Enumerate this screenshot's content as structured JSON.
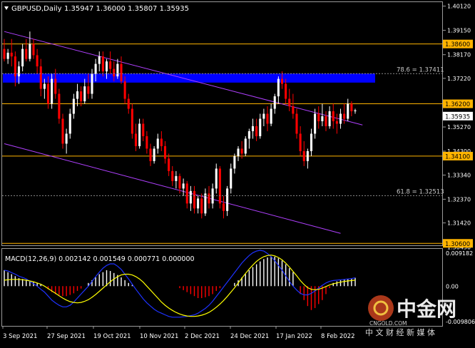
{
  "header": {
    "symbol_label": "GBPUSD,Daily",
    "ohlc_label": "1.35947 1.36000 1.35807 1.35935"
  },
  "macd_header": {
    "label": "MACD(12,26,9) 0.002142 0.001549 0.000771 0.000000"
  },
  "watermark": {
    "brand_cn": "中金网",
    "brand_url": "CNGOLD.COM",
    "tagline_cn": "中 文 财 经 新 媒 体"
  },
  "colors": {
    "background": "#000000",
    "bull": "#ffffff",
    "bear": "#ff0000",
    "level": "#ffb400",
    "zone": "#0000ff",
    "channel": "#b040ff",
    "macd_signal": "#ffff00",
    "macd_line": "#1e32ff",
    "macd_hist": "#ffffff"
  },
  "chart_data": {
    "type": "candlestick",
    "symbol": "GBPUSD",
    "timeframe": "Daily",
    "price_axis": {
      "range": [
        1.3055,
        1.4025
      ],
      "ticks": [
        "1.40120",
        "1.39150",
        "1.38170",
        "1.37220",
        "1.36250",
        "1.35270",
        "1.34300",
        "1.33340",
        "1.32370",
        "1.31420",
        "1.30450"
      ]
    },
    "date_axis": {
      "labels": [
        "3 Sep 2021",
        "27 Sep 2021",
        "19 Oct 2021",
        "10 Nov 2021",
        "2 Dec 2021",
        "24 Dec 2021",
        "17 Jan 2022",
        "8 Feb 2022"
      ]
    },
    "ohlc": [
      {
        "o": 1.384,
        "h": 1.388,
        "l": 1.379,
        "c": 1.38
      },
      {
        "o": 1.38,
        "h": 1.384,
        "l": 1.378,
        "c": 1.3825
      },
      {
        "o": 1.3825,
        "h": 1.388,
        "l": 1.377,
        "c": 1.381
      },
      {
        "o": 1.381,
        "h": 1.383,
        "l": 1.369,
        "c": 1.373
      },
      {
        "o": 1.373,
        "h": 1.379,
        "l": 1.37,
        "c": 1.377
      },
      {
        "o": 1.377,
        "h": 1.386,
        "l": 1.375,
        "c": 1.384
      },
      {
        "o": 1.384,
        "h": 1.388,
        "l": 1.379,
        "c": 1.38
      },
      {
        "o": 1.38,
        "h": 1.391,
        "l": 1.379,
        "c": 1.386
      },
      {
        "o": 1.386,
        "h": 1.388,
        "l": 1.38,
        "c": 1.3815
      },
      {
        "o": 1.3815,
        "h": 1.384,
        "l": 1.374,
        "c": 1.377
      },
      {
        "o": 1.377,
        "h": 1.38,
        "l": 1.365,
        "c": 1.368
      },
      {
        "o": 1.368,
        "h": 1.372,
        "l": 1.364,
        "c": 1.37
      },
      {
        "o": 1.37,
        "h": 1.373,
        "l": 1.36,
        "c": 1.362
      },
      {
        "o": 1.362,
        "h": 1.374,
        "l": 1.36,
        "c": 1.372
      },
      {
        "o": 1.372,
        "h": 1.376,
        "l": 1.364,
        "c": 1.366
      },
      {
        "o": 1.366,
        "h": 1.368,
        "l": 1.354,
        "c": 1.356
      },
      {
        "o": 1.356,
        "h": 1.358,
        "l": 1.344,
        "c": 1.346
      },
      {
        "o": 1.346,
        "h": 1.352,
        "l": 1.342,
        "c": 1.35
      },
      {
        "o": 1.35,
        "h": 1.36,
        "l": 1.348,
        "c": 1.358
      },
      {
        "o": 1.358,
        "h": 1.366,
        "l": 1.356,
        "c": 1.364
      },
      {
        "o": 1.364,
        "h": 1.37,
        "l": 1.361,
        "c": 1.367
      },
      {
        "o": 1.367,
        "h": 1.369,
        "l": 1.361,
        "c": 1.363
      },
      {
        "o": 1.363,
        "h": 1.372,
        "l": 1.362,
        "c": 1.369
      },
      {
        "o": 1.369,
        "h": 1.374,
        "l": 1.364,
        "c": 1.366
      },
      {
        "o": 1.366,
        "h": 1.376,
        "l": 1.364,
        "c": 1.374
      },
      {
        "o": 1.374,
        "h": 1.38,
        "l": 1.371,
        "c": 1.378
      },
      {
        "o": 1.378,
        "h": 1.383,
        "l": 1.375,
        "c": 1.381
      },
      {
        "o": 1.381,
        "h": 1.383,
        "l": 1.373,
        "c": 1.375
      },
      {
        "o": 1.375,
        "h": 1.38,
        "l": 1.372,
        "c": 1.379
      },
      {
        "o": 1.379,
        "h": 1.383,
        "l": 1.374,
        "c": 1.376
      },
      {
        "o": 1.376,
        "h": 1.379,
        "l": 1.371,
        "c": 1.373
      },
      {
        "o": 1.373,
        "h": 1.38,
        "l": 1.372,
        "c": 1.378
      },
      {
        "o": 1.378,
        "h": 1.381,
        "l": 1.37,
        "c": 1.371
      },
      {
        "o": 1.371,
        "h": 1.373,
        "l": 1.362,
        "c": 1.364
      },
      {
        "o": 1.364,
        "h": 1.366,
        "l": 1.358,
        "c": 1.36
      },
      {
        "o": 1.36,
        "h": 1.362,
        "l": 1.348,
        "c": 1.35
      },
      {
        "o": 1.35,
        "h": 1.354,
        "l": 1.343,
        "c": 1.345
      },
      {
        "o": 1.345,
        "h": 1.356,
        "l": 1.344,
        "c": 1.354
      },
      {
        "o": 1.354,
        "h": 1.356,
        "l": 1.347,
        "c": 1.349
      },
      {
        "o": 1.349,
        "h": 1.351,
        "l": 1.342,
        "c": 1.344
      },
      {
        "o": 1.344,
        "h": 1.346,
        "l": 1.337,
        "c": 1.339
      },
      {
        "o": 1.339,
        "h": 1.345,
        "l": 1.338,
        "c": 1.344
      },
      {
        "o": 1.344,
        "h": 1.35,
        "l": 1.342,
        "c": 1.348
      },
      {
        "o": 1.348,
        "h": 1.351,
        "l": 1.343,
        "c": 1.345
      },
      {
        "o": 1.345,
        "h": 1.347,
        "l": 1.338,
        "c": 1.34
      },
      {
        "o": 1.34,
        "h": 1.342,
        "l": 1.333,
        "c": 1.335
      },
      {
        "o": 1.335,
        "h": 1.337,
        "l": 1.329,
        "c": 1.331
      },
      {
        "o": 1.331,
        "h": 1.335,
        "l": 1.328,
        "c": 1.333
      },
      {
        "o": 1.333,
        "h": 1.334,
        "l": 1.326,
        "c": 1.328
      },
      {
        "o": 1.328,
        "h": 1.332,
        "l": 1.325,
        "c": 1.33
      },
      {
        "o": 1.33,
        "h": 1.331,
        "l": 1.32,
        "c": 1.322
      },
      {
        "o": 1.322,
        "h": 1.329,
        "l": 1.319,
        "c": 1.327
      },
      {
        "o": 1.327,
        "h": 1.329,
        "l": 1.318,
        "c": 1.32
      },
      {
        "o": 1.32,
        "h": 1.325,
        "l": 1.318,
        "c": 1.324
      },
      {
        "o": 1.324,
        "h": 1.326,
        "l": 1.316,
        "c": 1.318
      },
      {
        "o": 1.318,
        "h": 1.328,
        "l": 1.317,
        "c": 1.326
      },
      {
        "o": 1.326,
        "h": 1.329,
        "l": 1.32,
        "c": 1.322
      },
      {
        "o": 1.322,
        "h": 1.33,
        "l": 1.32,
        "c": 1.328
      },
      {
        "o": 1.328,
        "h": 1.338,
        "l": 1.326,
        "c": 1.336
      },
      {
        "o": 1.336,
        "h": 1.337,
        "l": 1.32,
        "c": 1.322
      },
      {
        "o": 1.322,
        "h": 1.325,
        "l": 1.316,
        "c": 1.319
      },
      {
        "o": 1.319,
        "h": 1.329,
        "l": 1.317,
        "c": 1.328
      },
      {
        "o": 1.328,
        "h": 1.338,
        "l": 1.326,
        "c": 1.336
      },
      {
        "o": 1.336,
        "h": 1.342,
        "l": 1.334,
        "c": 1.341
      },
      {
        "o": 1.341,
        "h": 1.345,
        "l": 1.339,
        "c": 1.344
      },
      {
        "o": 1.344,
        "h": 1.347,
        "l": 1.34,
        "c": 1.342
      },
      {
        "o": 1.342,
        "h": 1.349,
        "l": 1.341,
        "c": 1.348
      },
      {
        "o": 1.348,
        "h": 1.352,
        "l": 1.344,
        "c": 1.351
      },
      {
        "o": 1.351,
        "h": 1.356,
        "l": 1.348,
        "c": 1.353
      },
      {
        "o": 1.353,
        "h": 1.356,
        "l": 1.347,
        "c": 1.349
      },
      {
        "o": 1.349,
        "h": 1.358,
        "l": 1.348,
        "c": 1.356
      },
      {
        "o": 1.356,
        "h": 1.36,
        "l": 1.353,
        "c": 1.358
      },
      {
        "o": 1.358,
        "h": 1.361,
        "l": 1.351,
        "c": 1.354
      },
      {
        "o": 1.354,
        "h": 1.362,
        "l": 1.353,
        "c": 1.36
      },
      {
        "o": 1.36,
        "h": 1.366,
        "l": 1.358,
        "c": 1.365
      },
      {
        "o": 1.365,
        "h": 1.373,
        "l": 1.362,
        "c": 1.372
      },
      {
        "o": 1.372,
        "h": 1.375,
        "l": 1.368,
        "c": 1.37
      },
      {
        "o": 1.37,
        "h": 1.372,
        "l": 1.362,
        "c": 1.364
      },
      {
        "o": 1.364,
        "h": 1.368,
        "l": 1.359,
        "c": 1.361
      },
      {
        "o": 1.361,
        "h": 1.366,
        "l": 1.356,
        "c": 1.358
      },
      {
        "o": 1.358,
        "h": 1.36,
        "l": 1.348,
        "c": 1.35
      },
      {
        "o": 1.35,
        "h": 1.353,
        "l": 1.341,
        "c": 1.343
      },
      {
        "o": 1.343,
        "h": 1.347,
        "l": 1.337,
        "c": 1.339
      },
      {
        "o": 1.339,
        "h": 1.344,
        "l": 1.336,
        "c": 1.343
      },
      {
        "o": 1.343,
        "h": 1.352,
        "l": 1.341,
        "c": 1.35
      },
      {
        "o": 1.35,
        "h": 1.36,
        "l": 1.348,
        "c": 1.358
      },
      {
        "o": 1.358,
        "h": 1.361,
        "l": 1.352,
        "c": 1.355
      },
      {
        "o": 1.355,
        "h": 1.362,
        "l": 1.353,
        "c": 1.357
      },
      {
        "o": 1.357,
        "h": 1.359,
        "l": 1.351,
        "c": 1.353
      },
      {
        "o": 1.353,
        "h": 1.361,
        "l": 1.352,
        "c": 1.359
      },
      {
        "o": 1.359,
        "h": 1.362,
        "l": 1.352,
        "c": 1.355
      },
      {
        "o": 1.355,
        "h": 1.358,
        "l": 1.35,
        "c": 1.354
      },
      {
        "o": 1.354,
        "h": 1.36,
        "l": 1.352,
        "c": 1.358
      },
      {
        "o": 1.358,
        "h": 1.362,
        "l": 1.354,
        "c": 1.356
      },
      {
        "o": 1.356,
        "h": 1.364,
        "l": 1.355,
        "c": 1.362
      },
      {
        "o": 1.362,
        "h": 1.363,
        "l": 1.357,
        "c": 1.359
      },
      {
        "o": 1.359,
        "h": 1.36,
        "l": 1.358,
        "c": 1.35935
      }
    ],
    "horizontal_levels": [
      {
        "price": 1.386,
        "label": "1.38600"
      },
      {
        "price": 1.362,
        "label": "1.36200"
      },
      {
        "price": 1.341,
        "label": "1.34100"
      },
      {
        "price": 1.306,
        "label": "1.30600"
      }
    ],
    "current_price": {
      "price": 1.35935,
      "label": "1.35935"
    },
    "zone": {
      "top": 1.3741,
      "bottom": 1.3705
    },
    "fib_levels": [
      {
        "price": 1.3741,
        "label": "78.6 = 1.37411"
      },
      {
        "price": 1.32513,
        "label": "61.8 = 1.32513"
      }
    ],
    "channel_lines": [
      {
        "start": {
          "bar": 0,
          "price": 1.391
        },
        "end": {
          "bar": 98,
          "price": 1.3535
        }
      },
      {
        "start": {
          "bar": 0,
          "price": 1.346
        },
        "end": {
          "bar": 92,
          "price": 1.31
        }
      }
    ],
    "macd": {
      "params": "MACD(12,26,9)",
      "ticks": [
        "0.009182",
        "0.00",
        "-0.009806"
      ],
      "range": [
        -0.009806,
        0.009182
      ],
      "histogram": [
        0.004,
        0.0035,
        0.003,
        0.0025,
        0.002,
        0.0018,
        0.0015,
        0.0012,
        0.001,
        0.0008,
        0.0004,
        0.0,
        -0.0008,
        -0.0015,
        -0.002,
        -0.0022,
        -0.0025,
        -0.0025,
        -0.0022,
        -0.0018,
        -0.0012,
        -0.0006,
        0.0,
        0.0008,
        0.0015,
        0.0022,
        0.003,
        0.0035,
        0.004,
        0.0038,
        0.0033,
        0.0028,
        0.0022,
        0.0015,
        0.0008,
        0.0003,
        0.0,
        0.0,
        0.0,
        0.0,
        0.0,
        0.0,
        0.0,
        0.0,
        0.0,
        0.0,
        0.0,
        0.0,
        -0.0005,
        -0.001,
        -0.0015,
        -0.002,
        -0.0025,
        -0.003,
        -0.003,
        -0.0028,
        -0.0025,
        -0.002,
        -0.0012,
        -0.0005,
        0.0,
        0.0,
        0.0,
        0.0008,
        0.0015,
        0.0022,
        0.003,
        0.004,
        0.0048,
        0.0055,
        0.0062,
        0.0068,
        0.0072,
        0.0075,
        0.0074,
        0.007,
        0.0064,
        0.0055,
        0.0045,
        0.0035,
        0.0,
        -0.002,
        -0.0035,
        -0.005,
        -0.006,
        -0.0055,
        -0.0045,
        -0.0035,
        -0.002,
        -0.0005,
        0.0008,
        0.0012,
        0.0015,
        0.0017,
        0.0018,
        0.0019,
        0.0021
      ],
      "macd_line": [
        0.004,
        0.0038,
        0.0034,
        0.003,
        0.0025,
        0.0022,
        0.0018,
        0.0012,
        0.0006,
        0.0,
        -0.0008,
        -0.0015,
        -0.0025,
        -0.0035,
        -0.0042,
        -0.0048,
        -0.0052,
        -0.0052,
        -0.0048,
        -0.004,
        -0.003,
        -0.002,
        -0.001,
        0.0,
        0.0012,
        0.0024,
        0.0035,
        0.0045,
        0.0052,
        0.0056,
        0.0056,
        0.005,
        0.0042,
        0.003,
        0.0018,
        0.0005,
        -0.0008,
        -0.002,
        -0.0032,
        -0.0042,
        -0.005,
        -0.0058,
        -0.0064,
        -0.0068,
        -0.0072,
        -0.0076,
        -0.0078,
        -0.0078,
        -0.0078,
        -0.0077,
        -0.0076,
        -0.0074,
        -0.0072,
        -0.0068,
        -0.0062,
        -0.0056,
        -0.0048,
        -0.0038,
        -0.0026,
        -0.0014,
        -0.0002,
        0.001,
        0.0022,
        0.0034,
        0.0046,
        0.0058,
        0.0068,
        0.0077,
        0.0084,
        0.0088,
        0.009,
        0.0088,
        0.0082,
        0.0074,
        0.0064,
        0.0052,
        0.004,
        0.0026,
        0.0012,
        0.0,
        -0.001,
        -0.0018,
        -0.0022,
        -0.0022,
        -0.0018,
        -0.0012,
        -0.0005,
        0.0002,
        0.0008,
        0.0012,
        0.0014,
        0.0015,
        0.0016,
        0.0017,
        0.0018,
        0.0019,
        0.0021
      ],
      "signal_line": [
        0.0015,
        0.0016,
        0.0017,
        0.0017,
        0.0017,
        0.0016,
        0.0015,
        0.0013,
        0.0011,
        0.0008,
        0.0005,
        0.0,
        -0.0006,
        -0.0012,
        -0.0018,
        -0.0024,
        -0.003,
        -0.0035,
        -0.0039,
        -0.0041,
        -0.0042,
        -0.0041,
        -0.0038,
        -0.0034,
        -0.0028,
        -0.0021,
        -0.0013,
        -0.0005,
        0.0003,
        0.0011,
        0.0018,
        0.0024,
        0.0028,
        0.003,
        0.003,
        0.0028,
        0.0024,
        0.0018,
        0.001,
        0.0,
        -0.001,
        -0.002,
        -0.003,
        -0.004,
        -0.0048,
        -0.0055,
        -0.0061,
        -0.0066,
        -0.007,
        -0.0073,
        -0.0075,
        -0.0076,
        -0.0076,
        -0.0075,
        -0.0073,
        -0.007,
        -0.0066,
        -0.006,
        -0.0053,
        -0.0045,
        -0.0036,
        -0.0026,
        -0.0015,
        -0.0004,
        0.0008,
        0.002,
        0.0032,
        0.0043,
        0.0053,
        0.0062,
        0.0069,
        0.0074,
        0.0077,
        0.0078,
        0.0076,
        0.0072,
        0.0066,
        0.0058,
        0.0048,
        0.0037,
        0.0026,
        0.0014,
        0.0004,
        -0.0004,
        -0.0008,
        -0.0009,
        -0.0008,
        -0.0005,
        -0.0001,
        0.0003,
        0.0006,
        0.0008,
        0.001,
        0.0012,
        0.0013,
        0.0014,
        0.0015
      ]
    }
  }
}
